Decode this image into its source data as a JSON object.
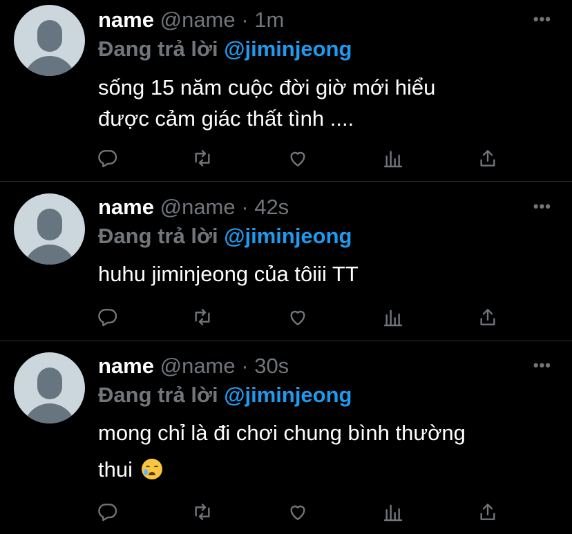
{
  "colors": {
    "background": "#000000",
    "text_primary": "#ffffff",
    "text_secondary": "#71767b",
    "mention": "#1d9bf0",
    "divider": "#2f3336",
    "avatar_bg": "#ccd6dd",
    "avatar_fg": "#66757f"
  },
  "icons": {
    "reply": "reply-icon",
    "retweet": "retweet-icon",
    "like": "like-icon",
    "analytics": "analytics-icon",
    "share": "share-icon",
    "more": "more-icon"
  },
  "tweets": [
    {
      "name": "name",
      "handle": "@name",
      "separator": "·",
      "time": "1m",
      "more": "•••",
      "reply_prefix": "Đang trả lời",
      "reply_to": "@jiminjeong",
      "text_line1": "sống 15 năm cuộc đời giờ mới hiểu",
      "text_line2": "được cảm giác thất tình ...."
    },
    {
      "name": "name",
      "handle": "@name",
      "separator": "·",
      "time": "42s",
      "more": "•••",
      "reply_prefix": "Đang trả lời",
      "reply_to": "@jiminjeong",
      "text_line1": "huhu jiminjeong của tôiii TT"
    },
    {
      "name": "name",
      "handle": "@name",
      "separator": "·",
      "time": "30s",
      "more": "•••",
      "reply_prefix": "Đang trả lời",
      "reply_to": "@jiminjeong",
      "text_line1": "mong chỉ là đi chơi chung bình thường",
      "text_line2": "thui",
      "emoji": "crying-face-emoji"
    }
  ]
}
